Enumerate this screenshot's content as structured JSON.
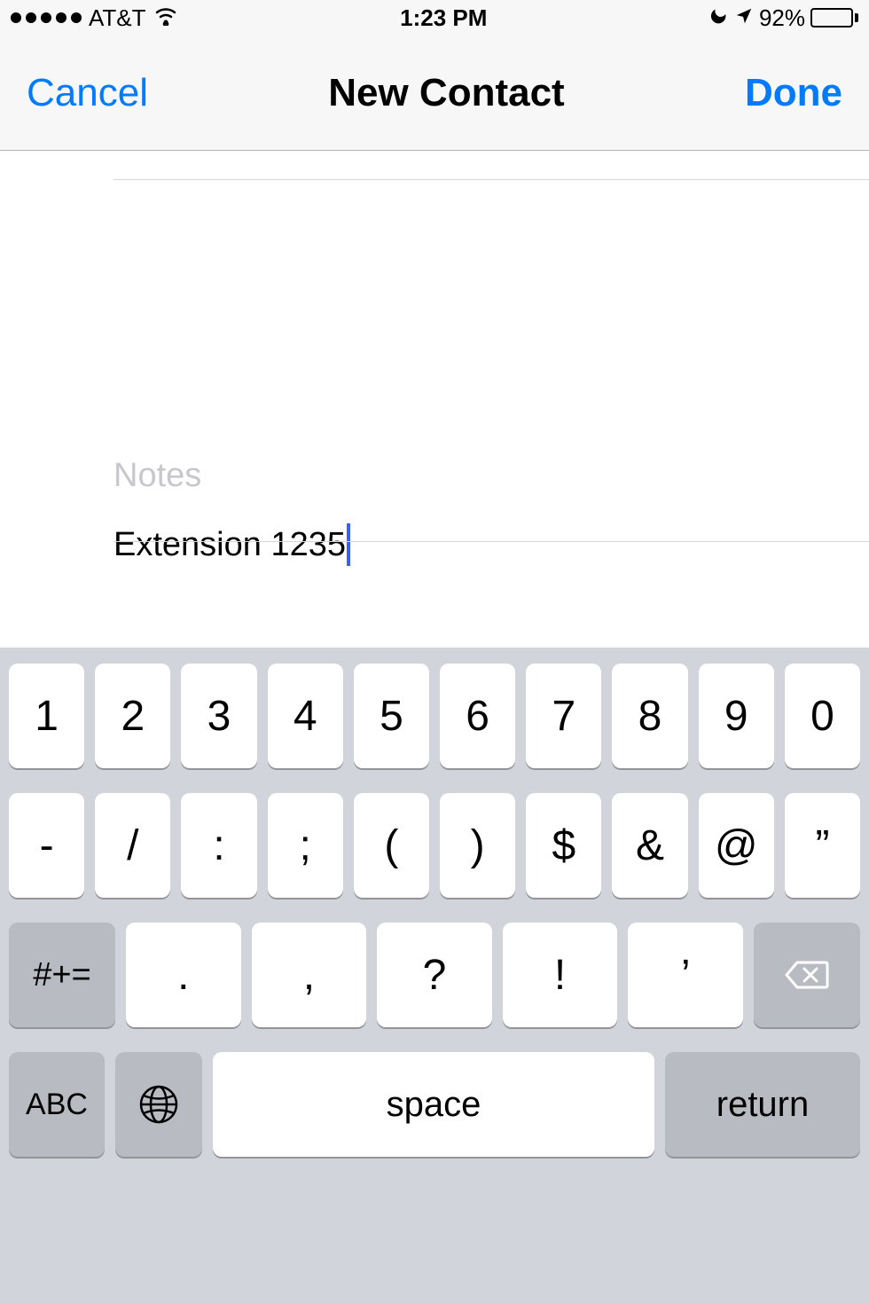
{
  "status": {
    "carrier": "AT&T",
    "time": "1:23 PM",
    "battery_pct": "92%"
  },
  "nav": {
    "cancel": "Cancel",
    "title": "New Contact",
    "done": "Done"
  },
  "form": {
    "notes_label": "Notes",
    "notes_value": "Extension 1235"
  },
  "keyboard": {
    "row1": [
      "1",
      "2",
      "3",
      "4",
      "5",
      "6",
      "7",
      "8",
      "9",
      "0"
    ],
    "row2": [
      "-",
      "/",
      ":",
      ";",
      "(",
      ")",
      "$",
      "&",
      "@",
      "”"
    ],
    "row3_symbol": "#+=",
    "row3_keys": [
      ".",
      ",",
      "?",
      "!",
      "’"
    ],
    "row4_abc": "ABC",
    "row4_space": "space",
    "row4_return": "return"
  }
}
